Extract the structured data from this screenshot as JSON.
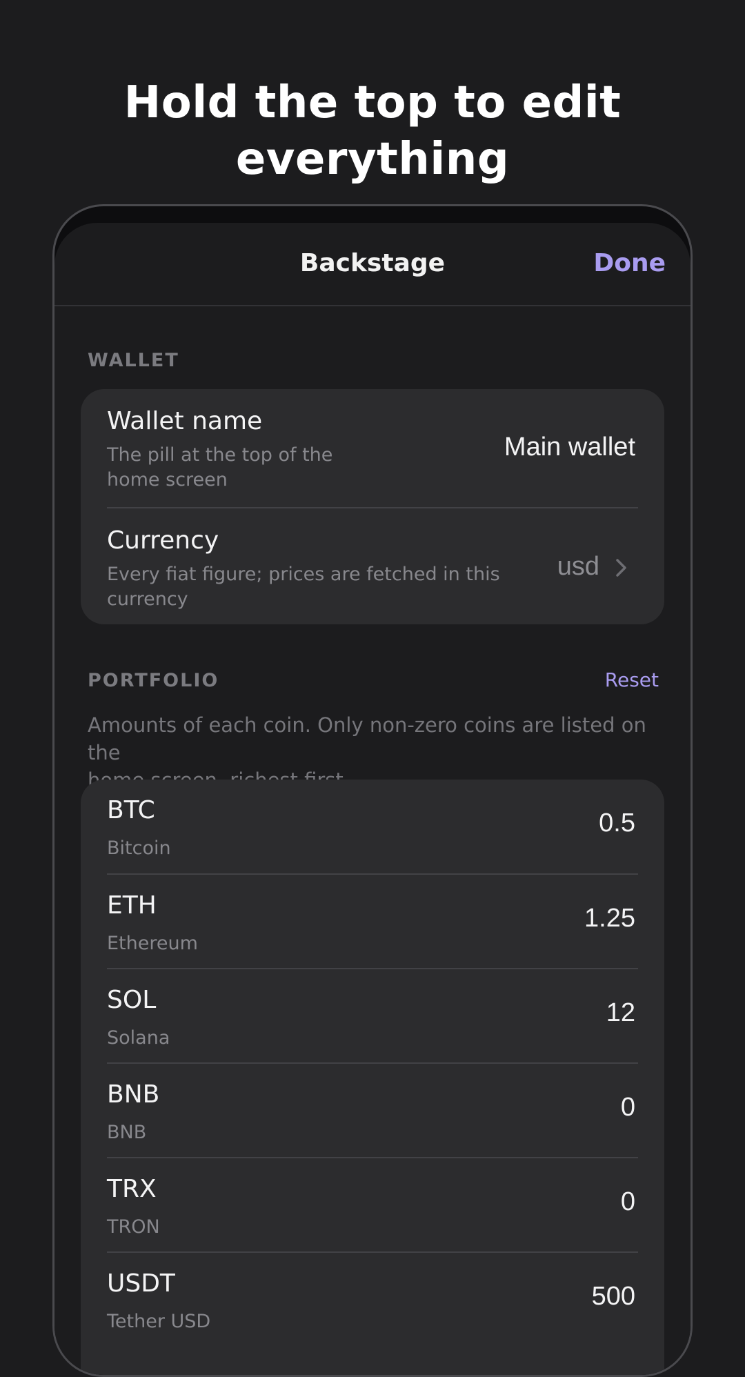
{
  "headline": {
    "line1": "Hold the top to edit",
    "line2": "everything"
  },
  "nav": {
    "title": "Backstage",
    "done_label": "Done"
  },
  "wallet_section": {
    "label": "WALLET",
    "wallet_name": {
      "title": "Wallet name",
      "subtitle_line1": "The pill at the top of the",
      "subtitle_line2": "home screen",
      "value": "Main wallet"
    },
    "currency": {
      "title": "Currency",
      "subtitle_line1": "Every fiat figure; prices are fetched in this",
      "subtitle_line2": "currency",
      "value": "usd"
    }
  },
  "portfolio_section": {
    "label": "PORTFOLIO",
    "reset_label": "Reset",
    "description_line1": "Amounts of each coin. Only non-zero coins are listed on the",
    "description_line2": "home screen, richest first",
    "coins": [
      {
        "symbol": "BTC",
        "name": "Bitcoin",
        "amount": "0.5"
      },
      {
        "symbol": "ETH",
        "name": "Ethereum",
        "amount": "1.25"
      },
      {
        "symbol": "SOL",
        "name": "Solana",
        "amount": "12"
      },
      {
        "symbol": "BNB",
        "name": "BNB",
        "amount": "0"
      },
      {
        "symbol": "TRX",
        "name": "TRON",
        "amount": "0"
      },
      {
        "symbol": "USDT",
        "name": "Tether USD",
        "amount": "500"
      }
    ]
  },
  "colors": {
    "background": "#1c1c1e",
    "card": "#2c2c2e",
    "accent": "#a99cf0",
    "secondary_text": "#88888d"
  }
}
